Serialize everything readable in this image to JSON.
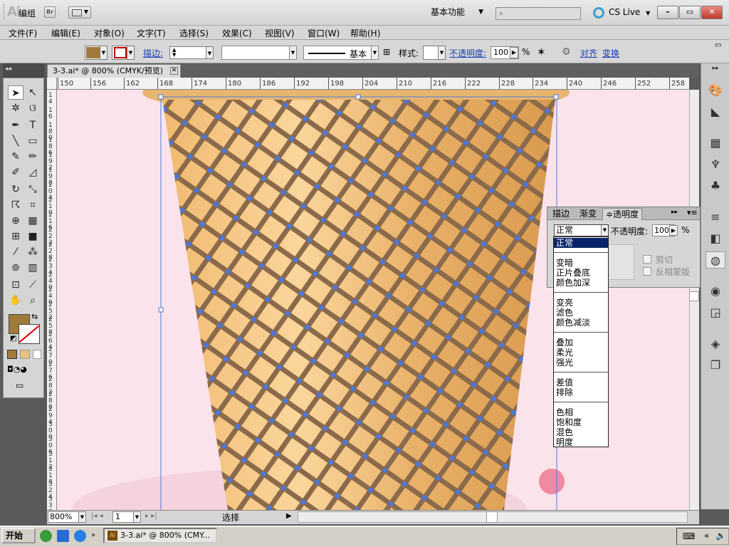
{
  "app": {
    "logo": "Ai",
    "bridge_label": "Br",
    "workspace": "基本功能",
    "cs_live": "CS Live",
    "window_controls": [
      "–",
      "▭",
      "✕"
    ]
  },
  "menubar": [
    "文件(F)",
    "编辑(E)",
    "对象(O)",
    "文字(T)",
    "选择(S)",
    "效果(C)",
    "视图(V)",
    "窗口(W)",
    "帮助(H)"
  ],
  "control": {
    "group_label": "编组",
    "stroke_label": "描边:",
    "brush_label": "基本",
    "style_label": "样式:",
    "opacity_label": "不透明度:",
    "opacity_value": "100",
    "opacity_unit": "%",
    "align_label": "对齐",
    "transform_label": "变换"
  },
  "colors": {
    "fill": "#a07a3a",
    "canvas_bg": "#fbe3ec",
    "selection": "#4a78e0",
    "waffle_light": "#f5c98b",
    "waffle_dark": "#d89b50",
    "lattice": "#8a6a4a"
  },
  "document": {
    "tab_title": "3-3.ai* @ 800% (CMYK/预览)",
    "close_icon": "✕"
  },
  "ruler": {
    "top_ticks": [
      "150",
      "156",
      "162",
      "168",
      "174",
      "180",
      "186",
      "192",
      "198",
      "204",
      "210",
      "216",
      "222",
      "228",
      "234",
      "240",
      "246",
      "252",
      "258"
    ],
    "left_ticks": [
      "1 4",
      "1 6",
      "1 8 0",
      "1 8 6",
      "1 9 2",
      "1 9 8",
      "2 0 4",
      "2 1 0",
      "2 1 6",
      "2 2 2",
      "2 2 8",
      "2 3 4",
      "2 4 0",
      "2 4 6",
      "2 5 2",
      "2 5 8",
      "2 6 4",
      "2 7 0",
      "2 7 6",
      "2 8 2",
      "2 8 8",
      "2 9 4",
      "3 0 0",
      "3 0 6",
      "3 1 2",
      "3 1 8",
      "3 2 4",
      "3 3 0"
    ]
  },
  "transparency_panel": {
    "tabs": [
      "描边",
      "渐变",
      "≑透明度"
    ],
    "blend_mode": "正常",
    "opacity_label": "不透明度:",
    "opacity_value": "100",
    "opacity_unit": "%",
    "clip_label": "剪切",
    "invert_label": "反相蒙版"
  },
  "blend_options": {
    "selected": "正常",
    "groups": [
      [
        "正常"
      ],
      [
        "变暗",
        "正片叠底",
        "颜色加深"
      ],
      [
        "变亮",
        "滤色",
        "颜色减淡"
      ],
      [
        "叠加",
        "柔光",
        "强光"
      ],
      [
        "差值",
        "排除"
      ],
      [
        "色相",
        "饱和度",
        "混色",
        "明度"
      ]
    ]
  },
  "status": {
    "zoom": "800%",
    "page": "1",
    "tool_status": "选择"
  },
  "taskbar": {
    "start": "开始",
    "task_item": "3-3.ai* @ 800% (CMY..."
  }
}
